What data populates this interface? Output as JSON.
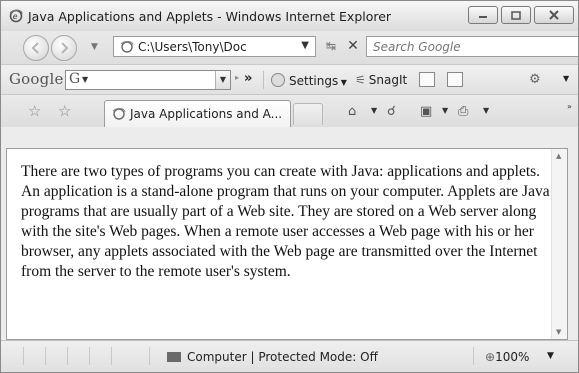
{
  "window": {
    "title": "Java Applications and Applets - Windows Internet Explorer",
    "controls": {
      "minimize": "▭",
      "maximize": "▢",
      "close": "✕"
    }
  },
  "address_bar": {
    "url": "C:\\Users\\Tony\\Doc",
    "search_placeholder": "Search Google"
  },
  "google_toolbar": {
    "logo": "Google",
    "search_mark": "G",
    "settings_label": "Settings",
    "snagit_label": "SnagIt"
  },
  "tabs": [
    {
      "label": "Java Applications and A..."
    }
  ],
  "page": {
    "paragraph": "There are two types of programs you can create with Java: applications and applets. An application is a stand-alone program that runs on your computer. Applets are Java programs that are usually part of a Web site. They are stored on a Web server along with the site's Web pages. When a remote user accesses a Web page with his or her browser, any applets associated with the Web page are transmitted over the Internet from the server to the remote user's system."
  },
  "status_bar": {
    "zone": "Computer | Protected Mode: Off",
    "zoom": "100%"
  },
  "icons": {
    "ie": "ie-icon",
    "back": "back-icon",
    "forward": "forward-icon",
    "refresh": "refresh-icon",
    "stop": "stop-icon",
    "favorites": "star-icon",
    "add_favorite": "add-favorite-icon",
    "home": "home-icon",
    "feeds": "feeds-icon",
    "print": "print-icon"
  }
}
